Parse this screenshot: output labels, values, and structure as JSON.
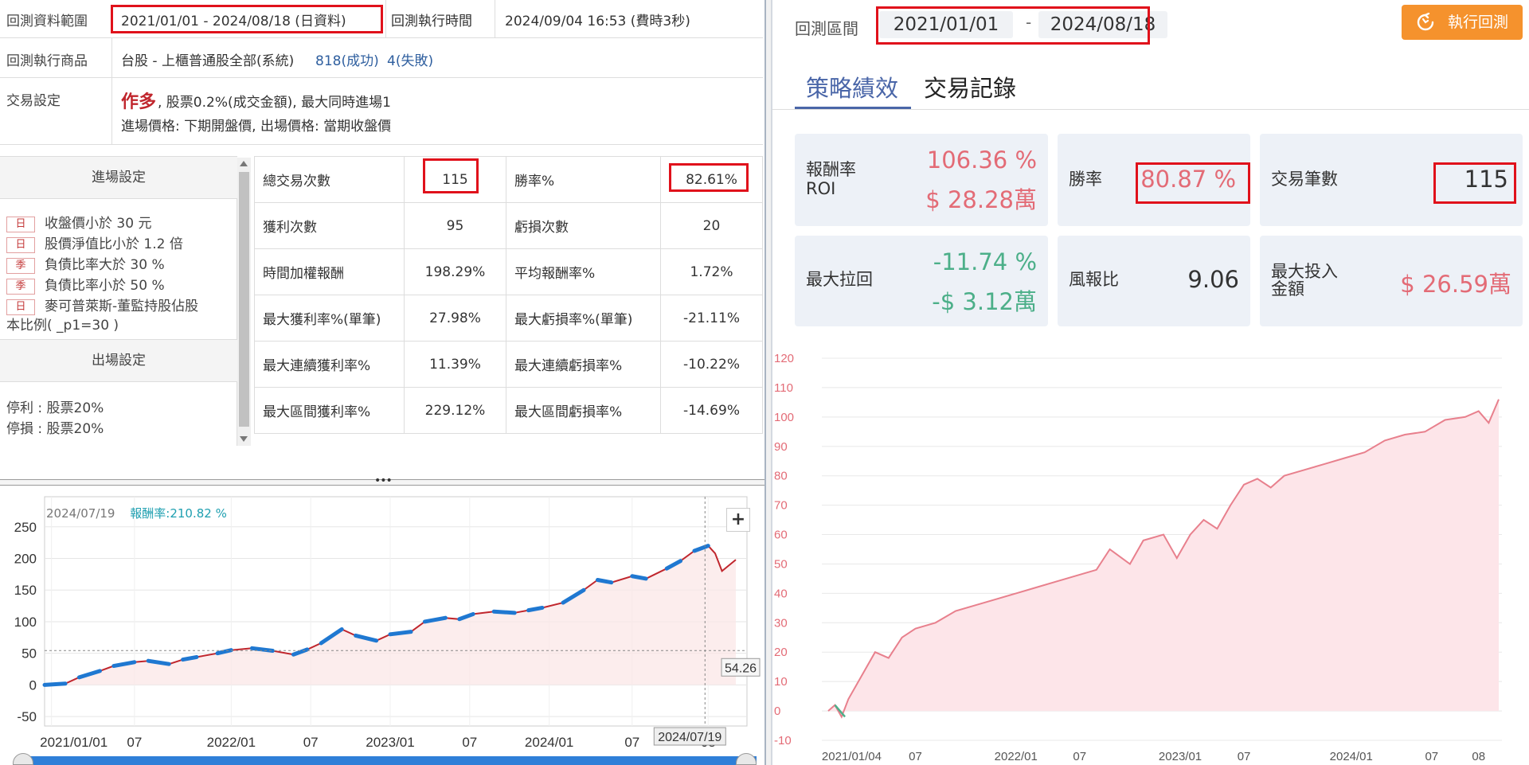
{
  "left": {
    "range": {
      "label": "回測資料範圍",
      "value": "2021/01/01 - 2024/08/18 (日資料)"
    },
    "exec_time": {
      "label": "回測執行時間",
      "value": "2024/09/04 16:53 (費時3秒)"
    },
    "product": {
      "label": "回測執行商品",
      "name": "台股 - 上櫃普通股全部(系統)",
      "success": "818(成功)",
      "fail": "4(失敗)"
    },
    "trade": {
      "label": "交易設定",
      "direction": "作多",
      "detail": ", 股票0.2%(成交金額), 最大同時進場1",
      "prices": "進場價格: 下期開盤價, 出場價格: 當期收盤價"
    },
    "entry": {
      "title": "進場設定",
      "conditions": [
        {
          "tag": "日",
          "text": "收盤價小於 30 元"
        },
        {
          "tag": "日",
          "text": "股價淨值比小於 1.2 倍"
        },
        {
          "tag": "季",
          "text": "負債比率大於 30 %"
        },
        {
          "tag": "季",
          "text": "負債比率小於 50 %"
        },
        {
          "tag": "日",
          "text": "麥可普萊斯-董監持股佔股"
        }
      ],
      "wrap": "本比例( _p1=30 )"
    },
    "exit": {
      "title": "出場設定",
      "stop_profit": "停利 : 股票20%",
      "stop_loss": "停損 : 股票20%"
    },
    "stats": [
      {
        "l1": "總交易次數",
        "v1": "115",
        "l2": "勝率%",
        "v2": "82.61%"
      },
      {
        "l1": "獲利次數",
        "v1": "95",
        "l2": "虧損次數",
        "v2": "20"
      },
      {
        "l1": "時間加權報酬",
        "v1": "198.29%",
        "l2": "平均報酬率%",
        "v2": "1.72%"
      },
      {
        "l1": "最大獲利率%(單筆)",
        "v1": "27.98%",
        "l2": "最大虧損率%(單筆)",
        "v2": "-21.11%"
      },
      {
        "l1": "最大連續獲利率%",
        "v1": "11.39%",
        "l2": "最大連續虧損率%",
        "v2": "-10.22%"
      },
      {
        "l1": "最大區間獲利率%",
        "v1": "229.12%",
        "l2": "最大區間虧損率%",
        "v2": "-14.69%"
      }
    ],
    "splitter": "•••",
    "chart_legend": {
      "date": "2024/07/19",
      "roi_label": "報酬率:",
      "roi_value": "210.82 %"
    },
    "plus": "+",
    "crosshair_value": "54.26",
    "crosshair_date": "2024/07/19"
  },
  "right": {
    "range_label": "回測區間",
    "start": "2021/01/01",
    "sep": "-",
    "end": "2024/08/18",
    "run_button": "執行回測",
    "tabs": [
      "策略績效",
      "交易記錄"
    ],
    "cards": {
      "roi_label": "報酬率",
      "roi_sub": "ROI",
      "roi_pct": "106.36 %",
      "roi_amt": "$ 28.28萬",
      "win_label": "勝率",
      "win_value": "80.87 %",
      "trades_label": "交易筆數",
      "trades_value": "115",
      "dd_label": "最大拉回",
      "dd_pct": "-11.74 %",
      "dd_amt": "-$ 3.12萬",
      "rr_label": "風報比",
      "rr_value": "9.06",
      "inv_label1": "最大投入",
      "inv_label2": "金額",
      "inv_value": "$ 26.59萬"
    }
  },
  "colors": {
    "accent_orange": "#f5922d",
    "highlight_red": "#e0111b",
    "pink": "#e36b76",
    "green": "#4caf89",
    "blue_series": "#1f78d1",
    "red_series": "#c0262d"
  },
  "chart_data": [
    {
      "type": "line",
      "title": "",
      "yticks": [
        250,
        200,
        150,
        100,
        50,
        0,
        -50
      ],
      "ylim": [
        -65,
        285
      ],
      "xticks": [
        "2021/01/01",
        "07",
        "2022/01",
        "07",
        "2023/01",
        "07",
        "2024/01",
        "07",
        "08"
      ],
      "reference_line": 54.26,
      "series": [
        {
          "x": [
            0,
            0.03,
            0.05,
            0.08,
            0.1,
            0.13,
            0.15,
            0.18,
            0.2,
            0.22,
            0.25,
            0.27,
            0.3,
            0.33,
            0.36,
            0.38,
            0.4,
            0.43,
            0.45,
            0.48,
            0.5,
            0.53,
            0.55,
            0.58,
            0.6,
            0.62,
            0.65,
            0.68,
            0.7,
            0.72,
            0.75,
            0.78,
            0.8,
            0.82,
            0.85,
            0.87,
            0.9,
            0.92,
            0.94,
            0.96,
            0.97,
            0.98,
            1.0
          ],
          "values": [
            0,
            2,
            12,
            22,
            30,
            36,
            38,
            33,
            40,
            44,
            50,
            55,
            58,
            54,
            48,
            56,
            66,
            88,
            78,
            70,
            80,
            84,
            100,
            106,
            104,
            112,
            116,
            114,
            118,
            122,
            130,
            150,
            166,
            162,
            172,
            168,
            184,
            196,
            212,
            220,
            208,
            180,
            198
          ]
        }
      ]
    },
    {
      "type": "area",
      "title": "",
      "yticks": [
        120,
        110,
        100,
        90,
        80,
        70,
        60,
        50,
        40,
        30,
        20,
        10,
        0,
        -10
      ],
      "ylim": [
        -10,
        120
      ],
      "xticks": [
        "2021/01/04",
        "07",
        "2022/01",
        "07",
        "2023/01",
        "07",
        "2024/01",
        "07",
        "08"
      ],
      "series": [
        {
          "x": [
            0,
            0.01,
            0.02,
            0.03,
            0.05,
            0.07,
            0.09,
            0.11,
            0.13,
            0.16,
            0.19,
            0.22,
            0.25,
            0.28,
            0.31,
            0.34,
            0.37,
            0.4,
            0.42,
            0.45,
            0.47,
            0.5,
            0.52,
            0.54,
            0.56,
            0.58,
            0.6,
            0.62,
            0.64,
            0.66,
            0.68,
            0.71,
            0.74,
            0.77,
            0.8,
            0.83,
            0.86,
            0.89,
            0.92,
            0.95,
            0.97,
            0.985,
            1.0
          ],
          "values": [
            0,
            2,
            -2,
            4,
            12,
            20,
            18,
            25,
            28,
            30,
            34,
            36,
            38,
            40,
            42,
            44,
            46,
            48,
            55,
            50,
            58,
            60,
            52,
            60,
            65,
            62,
            70,
            77,
            79,
            76,
            80,
            82,
            84,
            86,
            88,
            92,
            94,
            95,
            99,
            100,
            102,
            98,
            106
          ]
        }
      ]
    }
  ]
}
